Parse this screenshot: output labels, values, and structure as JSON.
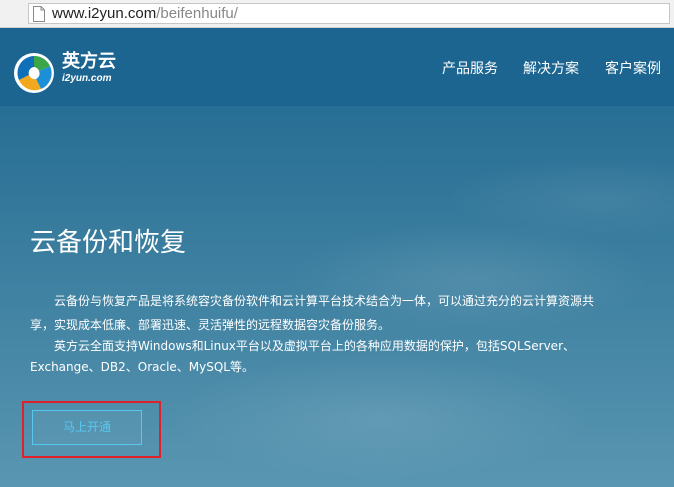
{
  "browser": {
    "url_host": "www.i2yun.com",
    "url_path": "/beifenhuifu/"
  },
  "brand": {
    "name": "英方云",
    "domain": "i2yun.com"
  },
  "nav": {
    "items": [
      {
        "label": "产品服务"
      },
      {
        "label": "解决方案"
      },
      {
        "label": "客户案例"
      }
    ]
  },
  "hero": {
    "title": "云备份和恢复",
    "desc_lines": [
      "云备份与恢复产品是将系统容灾备份软件和云计算平台技术结合为一体，可以通过充分的云计算资源共",
      "享，实现成本低廉、部署迅速、灵活弹性的远程数据容灾备份服务。",
      "英方云全面支持Windows和Linux平台以及虚拟平台上的各种应用数据的保护，包括SQLServer、",
      "Exchange、DB2、Oracle、MySQL等。"
    ],
    "cta_label": "马上开通"
  },
  "colors": {
    "navbar_bg": "#1c6591",
    "cta_accent": "#58c7ef",
    "annotation_red": "#e0202a"
  },
  "icons": {
    "page": "page-icon",
    "logo": "logo-icon"
  }
}
